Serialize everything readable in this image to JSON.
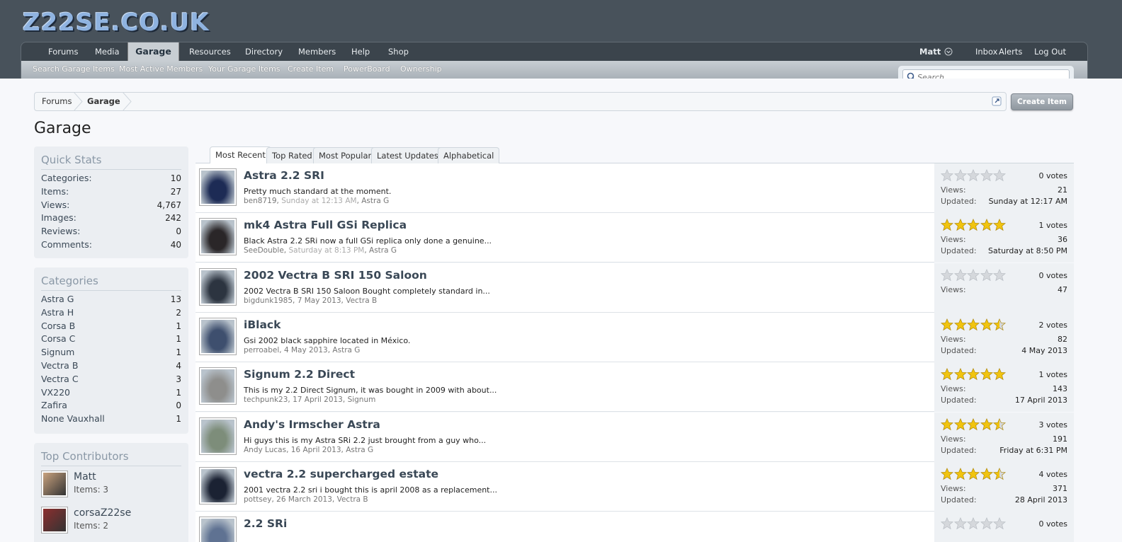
{
  "site": {
    "logo_text": "Z22SE.CO.UK"
  },
  "nav": {
    "tabs": [
      {
        "label": "Forums"
      },
      {
        "label": "Media"
      },
      {
        "label": "Garage"
      },
      {
        "label": "Resources"
      },
      {
        "label": "Directory"
      },
      {
        "label": "Members"
      },
      {
        "label": "Help"
      },
      {
        "label": "Shop"
      }
    ],
    "active_tab": "Garage",
    "user": "Matt",
    "inbox": "Inbox",
    "alerts": "Alerts",
    "logout": "Log Out"
  },
  "subnav": {
    "items": [
      "Search Garage Items",
      "Most Active Members",
      "Your Garage Items",
      "Create Item",
      "PowerBoard",
      "Ownership"
    ]
  },
  "search": {
    "placeholder": "Search..."
  },
  "breadcrumb": [
    "Forums",
    "Garage"
  ],
  "create_item_label": "Create Item",
  "page_title": "Garage",
  "quick_stats": {
    "title": "Quick Stats",
    "rows": [
      {
        "label": "Categories:",
        "value": "10"
      },
      {
        "label": "Items:",
        "value": "27"
      },
      {
        "label": "Views:",
        "value": "4,767"
      },
      {
        "label": "Images:",
        "value": "242"
      },
      {
        "label": "Reviews:",
        "value": "0"
      },
      {
        "label": "Comments:",
        "value": "40"
      }
    ]
  },
  "categories": {
    "title": "Categories",
    "rows": [
      {
        "label": "Astra G",
        "value": "13"
      },
      {
        "label": "Astra H",
        "value": "2"
      },
      {
        "label": "Corsa B",
        "value": "1"
      },
      {
        "label": "Corsa C",
        "value": "1"
      },
      {
        "label": "Signum",
        "value": "1"
      },
      {
        "label": "Vectra B",
        "value": "4"
      },
      {
        "label": "Vectra C",
        "value": "3"
      },
      {
        "label": "VX220",
        "value": "1"
      },
      {
        "label": "Zafira",
        "value": "0"
      },
      {
        "label": "None Vauxhall",
        "value": "1"
      }
    ]
  },
  "top_contributors": {
    "title": "Top Contributors",
    "rows": [
      {
        "name": "Matt",
        "items": "Items: 3"
      },
      {
        "name": "corsaZ22se",
        "items": "Items: 2"
      }
    ]
  },
  "list_tabs": [
    "Most Recent",
    "Top Rated",
    "Most Popular",
    "Latest Updates",
    "Alphabetical"
  ],
  "active_list_tab": "Most Recent",
  "stat_labels": {
    "views": "Views:",
    "updated": "Updated:"
  },
  "items": [
    {
      "title": "Astra 2.2 SRI",
      "desc": "Pretty much standard at the moment.",
      "author": "ben8719",
      "date": "Sunday at 12:13 AM",
      "category": "Astra G",
      "rating": 0,
      "votes": "0 votes",
      "views": "21",
      "updated": "Sunday at 12:17 AM",
      "thumb_color": "#1d2b55"
    },
    {
      "title": "mk4 Astra Full GSi Replica",
      "desc": "Black Astra 2.2 SRi now a full GSi replica only done a genuine...",
      "author": "SeeDouble",
      "date": "Saturday at 8:13 PM",
      "category": "Astra G",
      "rating": 5,
      "votes": "1 votes",
      "views": "36",
      "updated": "Saturday at 8:50 PM",
      "thumb_color": "#2a2628"
    },
    {
      "title": "2002 Vectra B SRI 150 Saloon",
      "desc": "2002 Vectra B SRI 150 Saloon Bought completely standard in...",
      "author": "bigdunk1985",
      "date": "7 May 2013",
      "category": "Vectra B",
      "rating": 0,
      "votes": "0 votes",
      "views": "47",
      "updated": "",
      "thumb_color": "#2c3440"
    },
    {
      "title": "iBlack",
      "desc": "Gsi 2002 black sapphire located in México.",
      "author": "perroabel",
      "date": "4 May 2013",
      "category": "Astra G",
      "rating": 4.5,
      "votes": "2 votes",
      "views": "82",
      "updated": "4 May 2013",
      "thumb_color": "#3e4f6e"
    },
    {
      "title": "Signum 2.2 Direct",
      "desc": "This is my 2.2 Direct Signum, it was bought in 2009 with about...",
      "author": "techpunk23",
      "date": "17 April 2013",
      "category": "Signum",
      "rating": 5,
      "votes": "1 votes",
      "views": "143",
      "updated": "17 April 2013",
      "thumb_color": "#8e8e8c"
    },
    {
      "title": "Andy's Irmscher Astra",
      "desc": "Hi guys this is my Astra SRi 2.2 just brought from a guy who...",
      "author": "Andy Lucas",
      "date": "16 April 2013",
      "category": "Astra G",
      "rating": 4.5,
      "votes": "3 votes",
      "views": "191",
      "updated": "Friday at 6:31 PM",
      "thumb_color": "#7d8d7a"
    },
    {
      "title": "vectra 2.2 supercharged estate",
      "desc": "2001 vectra 2.2 sri i bought this is april 2008 as a replacement...",
      "author": "pottsey",
      "date": "26 March 2013",
      "category": "Vectra B",
      "rating": 4.5,
      "votes": "4 votes",
      "views": "371",
      "updated": "28 April 2013",
      "thumb_color": "#1b2233"
    },
    {
      "title": "2.2 SRi",
      "desc": "",
      "author": "",
      "date": "",
      "category": "",
      "rating": 0,
      "votes": "0 votes",
      "views": "",
      "updated": "",
      "thumb_color": "#5f7292"
    }
  ],
  "colors": {
    "header_bg": "#48525b",
    "nav_bg": "#3b444c",
    "star_gold": "#f1c40f",
    "star_grey": "#d5d8dc"
  }
}
